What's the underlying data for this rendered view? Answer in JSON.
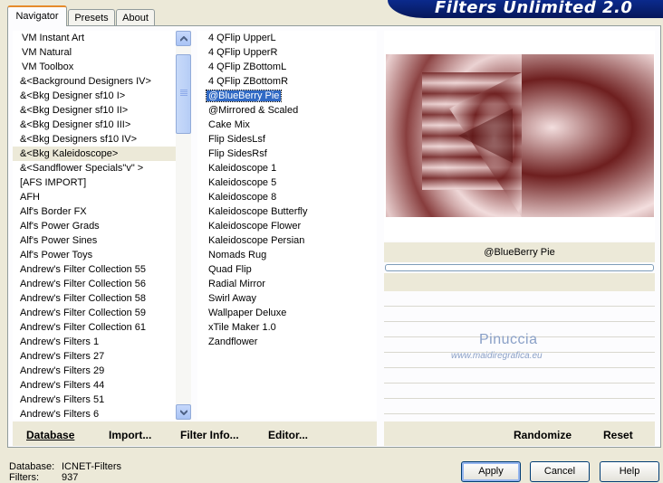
{
  "header": {
    "title": "Filters Unlimited 2.0"
  },
  "tabs": [
    {
      "label": "Navigator",
      "active": true
    },
    {
      "label": "Presets",
      "active": false
    },
    {
      "label": "About",
      "active": false
    }
  ],
  "categories": [
    "VM Instant Art",
    "VM Natural",
    "VM Toolbox",
    "&<Background Designers IV>",
    "&<Bkg Designer sf10 I>",
    "&<Bkg Designer sf10 II>",
    "&<Bkg Designer sf10 III>",
    "&<Bkg Designers sf10 IV>",
    "&<Bkg Kaleidoscope>",
    "&<Sandflower Specials\"v\" >",
    "[AFS IMPORT]",
    "AFH",
    "Alf's Border FX",
    "Alf's Power Grads",
    "Alf's Power Sines",
    "Alf's Power Toys",
    "Andrew's Filter Collection 55",
    "Andrew's Filter Collection 56",
    "Andrew's Filter Collection 58",
    "Andrew's Filter Collection 59",
    "Andrew's Filter Collection 61",
    "Andrew's Filters 1",
    "Andrew's Filters 27",
    "Andrew's Filters 29",
    "Andrew's Filters 44",
    "Andrew's Filters 51",
    "Andrew's Filters 6"
  ],
  "selected_category_index": 8,
  "filters": [
    "4 QFlip UpperL",
    "4 QFlip UpperR",
    "4 QFlip ZBottomL",
    "4 QFlip ZBottomR",
    "@BlueBerry Pie",
    "@Mirrored & Scaled",
    "Cake Mix",
    "Flip SidesLsf",
    "Flip SidesRsf",
    "Kaleidoscope 1",
    "Kaleidoscope 5",
    "Kaleidoscope 8",
    "Kaleidoscope Butterfly",
    "Kaleidoscope Flower",
    "Kaleidoscope Persian",
    "Nomads Rug",
    "Quad Flip",
    "Radial Mirror",
    "Swirl Away",
    "Wallpaper Deluxe",
    "xTile Maker 1.0",
    "Zandflower"
  ],
  "selected_filter_index": 4,
  "preview": {
    "filter_name": "@BlueBerry Pie",
    "colors": {
      "dark": "#6e1f1f",
      "light": "#f3dede"
    }
  },
  "watermark": {
    "name": "Pinuccia",
    "site": "www.maidiregrafica.eu"
  },
  "left_actions": [
    {
      "label": "Database",
      "accel": "D"
    },
    {
      "label": "Import...",
      "accel": "I"
    },
    {
      "label": "Filter Info...",
      "accel": "I"
    },
    {
      "label": "Editor...",
      "accel": "E"
    }
  ],
  "right_actions": {
    "randomize": "Randomize",
    "reset": "Reset"
  },
  "status": {
    "database_label": "Database:",
    "database_value": "ICNET-Filters",
    "filters_label": "Filters:",
    "filters_value": "937"
  },
  "buttons": {
    "apply": "Apply",
    "cancel": "Cancel",
    "help": "Help"
  }
}
